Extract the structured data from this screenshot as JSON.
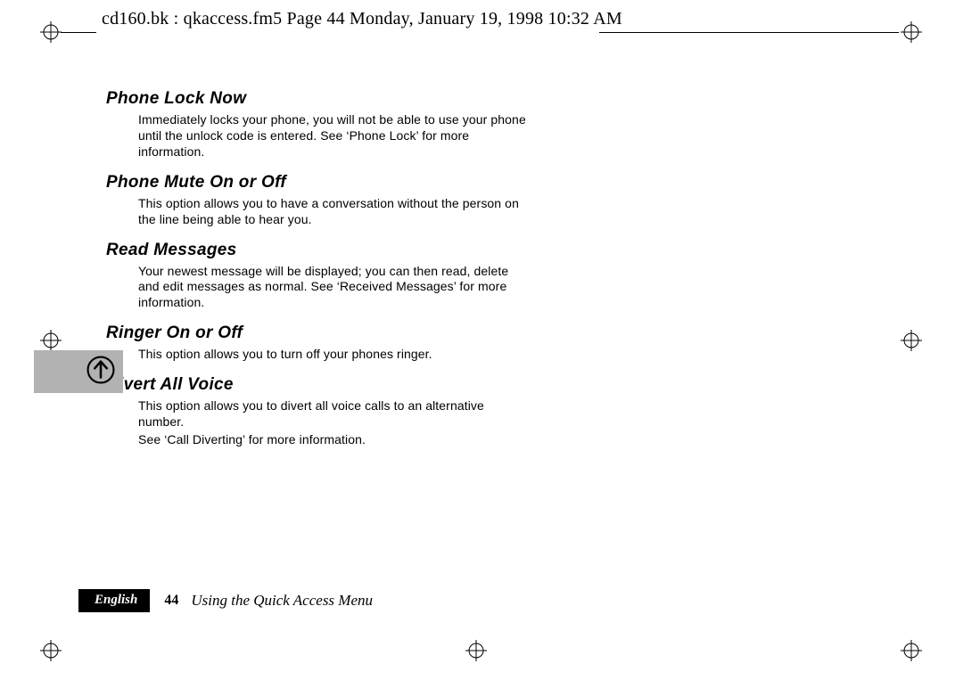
{
  "header": {
    "slug": "cd160.bk : qkaccess.fm5  Page 44  Monday, January 19, 1998  10:32 AM"
  },
  "sections": [
    {
      "heading": "Phone Lock Now",
      "body": "Immediately locks your phone, you will not be able to use your phone until the unlock code is entered. See ‘Phone Lock’ for more information."
    },
    {
      "heading": "Phone Mute On or Off",
      "body": "This option allows you to have a conversation without the person on the line being able to hear you."
    },
    {
      "heading": "Read Messages",
      "body": "Your newest message will be displayed; you can then read, delete and edit messages as normal. See ‘Received Messages’ for more information."
    },
    {
      "heading": "Ringer On or Off",
      "body": "This option allows you to turn off your phones ringer."
    },
    {
      "heading": "Divert All Voice",
      "body": "This option allows you to divert all voice calls to an alternative number.",
      "body2": "See ‘Call Diverting’ for more information."
    }
  ],
  "sidebar": {
    "icon_name": "up-arrow-circle"
  },
  "footer": {
    "language": "English",
    "page": "44",
    "chapter": "Using the Quick Access Menu"
  }
}
